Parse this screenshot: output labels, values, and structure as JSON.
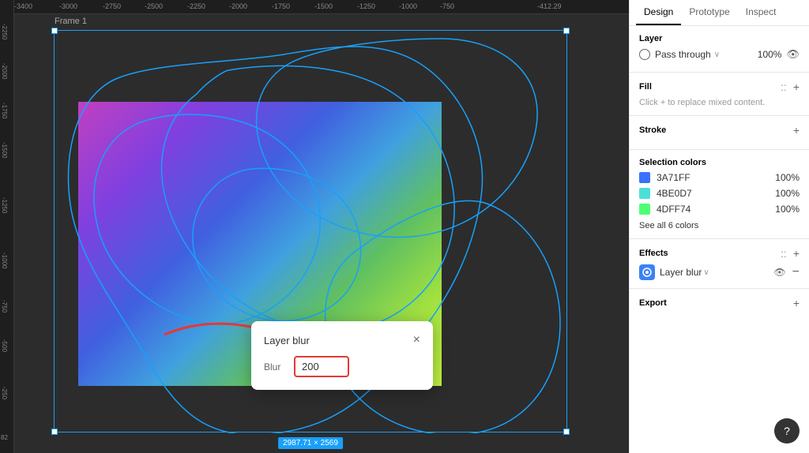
{
  "tabs": {
    "design": "Design",
    "prototype": "Prototype",
    "inspect": "Inspect",
    "active": "Design"
  },
  "ruler": {
    "top_values": [
      "-3400",
      "-3000",
      "-2750",
      "-2500",
      "-2250",
      "-2000",
      "-1750",
      "-1500",
      "-1250",
      "-1000",
      "-750",
      "-412.29"
    ],
    "left_values": [
      "-2250",
      "-2000",
      "-1750",
      "-1500",
      "-1250",
      "-1000",
      "-750",
      "-500",
      "-250",
      "82"
    ]
  },
  "canvas": {
    "frame_label": "Frame 1",
    "dimension_label": "2987.71 × 2569"
  },
  "layer_blur_popup": {
    "title": "Layer blur",
    "close_icon": "×",
    "blur_label": "Blur",
    "blur_value": "200"
  },
  "panel": {
    "layer_section": {
      "title": "Layer",
      "blend_mode": "Pass through",
      "opacity": "100%"
    },
    "fill_section": {
      "title": "Fill",
      "hint": "Click + to replace mixed content.",
      "add_icon": "+"
    },
    "stroke_section": {
      "title": "Stroke",
      "add_icon": "+"
    },
    "selection_colors": {
      "title": "Selection colors",
      "colors": [
        {
          "hex": "3A71FF",
          "pct": "100%",
          "color": "#3A71FF"
        },
        {
          "hex": "4BE0D7",
          "pct": "100%",
          "color": "#4BE0D7"
        },
        {
          "hex": "4DFF74",
          "pct": "100%",
          "color": "#4DFF74"
        }
      ],
      "see_all": "See all 6 colors"
    },
    "effects_section": {
      "title": "Effects",
      "add_icon": "+",
      "effect_name": "Layer blur",
      "effect_chevron": "∨"
    },
    "export_section": {
      "title": "Export",
      "add_icon": "+"
    }
  },
  "help": {
    "label": "?"
  }
}
